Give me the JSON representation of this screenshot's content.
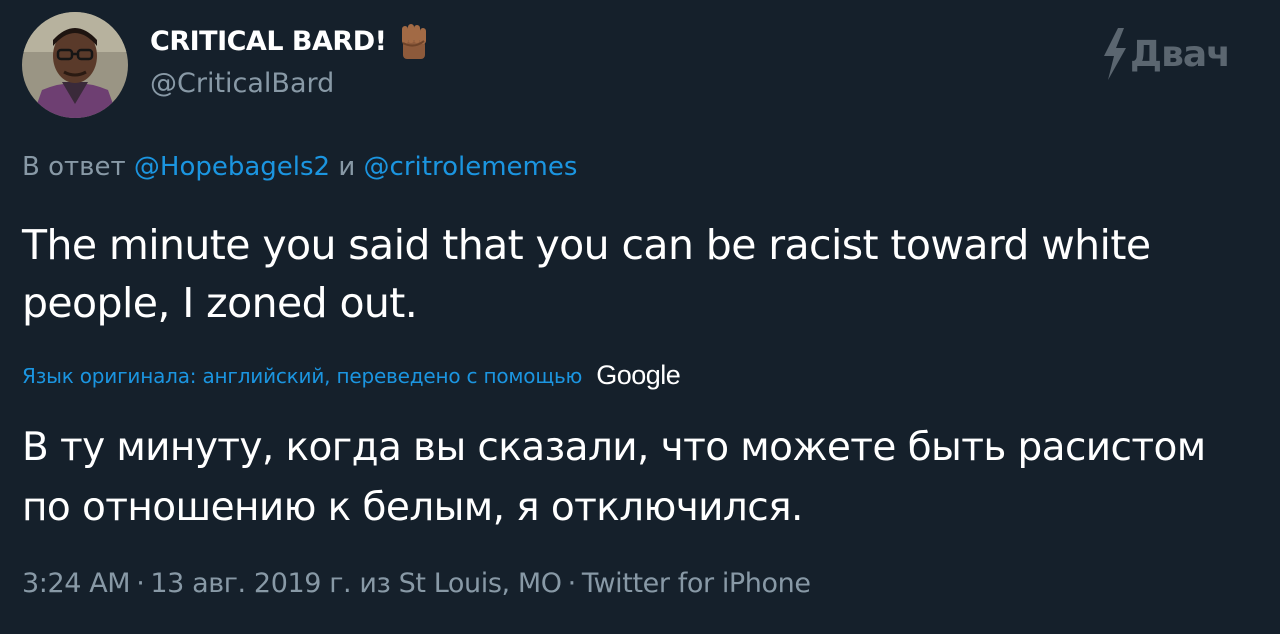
{
  "author": {
    "display_name": "CRITICAL BARD!",
    "handle": "@CriticalBard",
    "badge_icon": "raised-fist-emoji"
  },
  "watermark": {
    "text": "Двач",
    "icon": "lightning-bolt-icon"
  },
  "reply": {
    "prefix": "В ответ",
    "mention_1": "@Hopebagels2",
    "conjunction": "и",
    "mention_2": "@critrolememes"
  },
  "tweet": {
    "text": "The minute you said that you can be racist toward white people, I zoned out."
  },
  "translation": {
    "label": "Язык оригинала: английский, переведено с помощью",
    "provider": "Google",
    "text": "В ту минуту, когда вы сказали, что можете быть расистом по отношению к белым, я отключился."
  },
  "meta": {
    "time": "3:24 AM",
    "date": "13 авг. 2019 г. из St Louis, MO",
    "source": "Twitter for iPhone",
    "separator": "·"
  },
  "colors": {
    "background": "#15202b",
    "link": "#1b95e0",
    "secondary_text": "#8899a6",
    "primary_text": "#ffffff"
  }
}
